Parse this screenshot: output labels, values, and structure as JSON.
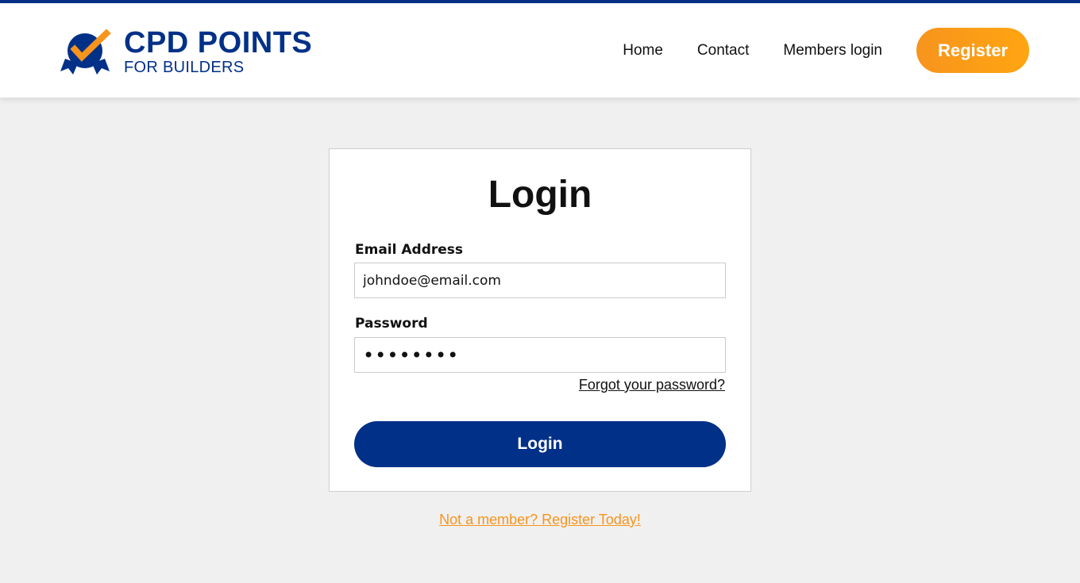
{
  "colors": {
    "brand_blue": "#003087",
    "accent_orange": "#f7941d",
    "page_background": "#f0f0f0"
  },
  "header": {
    "logo": {
      "icon": "badge-checkmark-icon",
      "title": "CPD POINTS",
      "subtitle": "FOR BUILDERS"
    },
    "nav": {
      "home": "Home",
      "contact": "Contact",
      "members_login": "Members login",
      "register": "Register"
    }
  },
  "login_form": {
    "title": "Login",
    "email_label": "Email Address",
    "email_value": "johndoe@email.com",
    "password_label": "Password",
    "password_value": "••••••••",
    "forgot_password": "Forgot your password?",
    "submit_label": "Login"
  },
  "footer_link": "Not a member? Register Today!"
}
